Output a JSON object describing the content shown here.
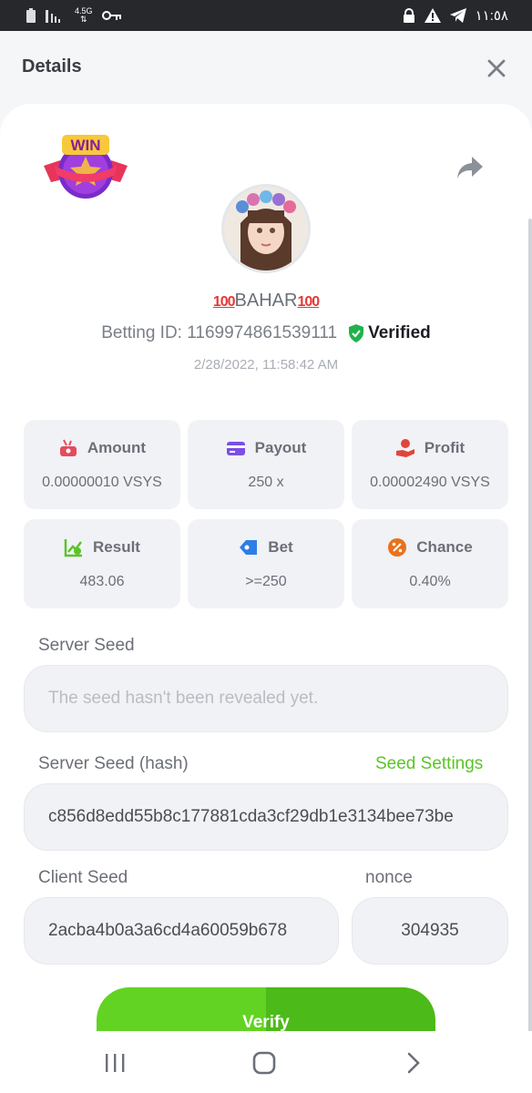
{
  "status_bar": {
    "network_label": "4.5G",
    "time": "١١:٥٨"
  },
  "header": {
    "title": "Details"
  },
  "bet": {
    "badge_text": "WIN",
    "username": "BAHAR",
    "username_emoji": "100",
    "betting_id_label": "Betting ID:",
    "betting_id": "1169974861539111",
    "verified_label": "Verified",
    "timestamp": "2/28/2022, 11:58:42 AM"
  },
  "stats": [
    {
      "label": "Amount",
      "value": "0.00000010 VSYS",
      "icon": "amount-icon",
      "color": "#e54b5c"
    },
    {
      "label": "Payout",
      "value": "250 x",
      "icon": "card-icon",
      "color": "#7b4ee6"
    },
    {
      "label": "Profit",
      "value": "0.00002490 VSYS",
      "icon": "hand-coin-icon",
      "color": "#e0453c"
    },
    {
      "label": "Result",
      "value": "483.06",
      "icon": "chart-icon",
      "color": "#5bc42a"
    },
    {
      "label": "Bet",
      "value": ">=250",
      "icon": "tag-icon",
      "color": "#2f7ee6"
    },
    {
      "label": "Chance",
      "value": "0.40%",
      "icon": "percent-icon",
      "color": "#e8721c"
    }
  ],
  "server_seed": {
    "label": "Server Seed",
    "placeholder": "The seed hasn't been revealed yet."
  },
  "server_seed_hash": {
    "label": "Server Seed (hash)",
    "link": "Seed Settings",
    "value": "c856d8edd55b8c177881cda3cf29db1e3134bee73be"
  },
  "client_seed": {
    "label": "Client Seed",
    "value": "2acba4b0a3a6cd4a60059b678"
  },
  "nonce": {
    "label": "nonce",
    "value": "304935"
  },
  "verify_button": {
    "label": "Verify"
  },
  "colors": {
    "accent_green": "#5bc42a",
    "verified_green": "#22b14c"
  }
}
